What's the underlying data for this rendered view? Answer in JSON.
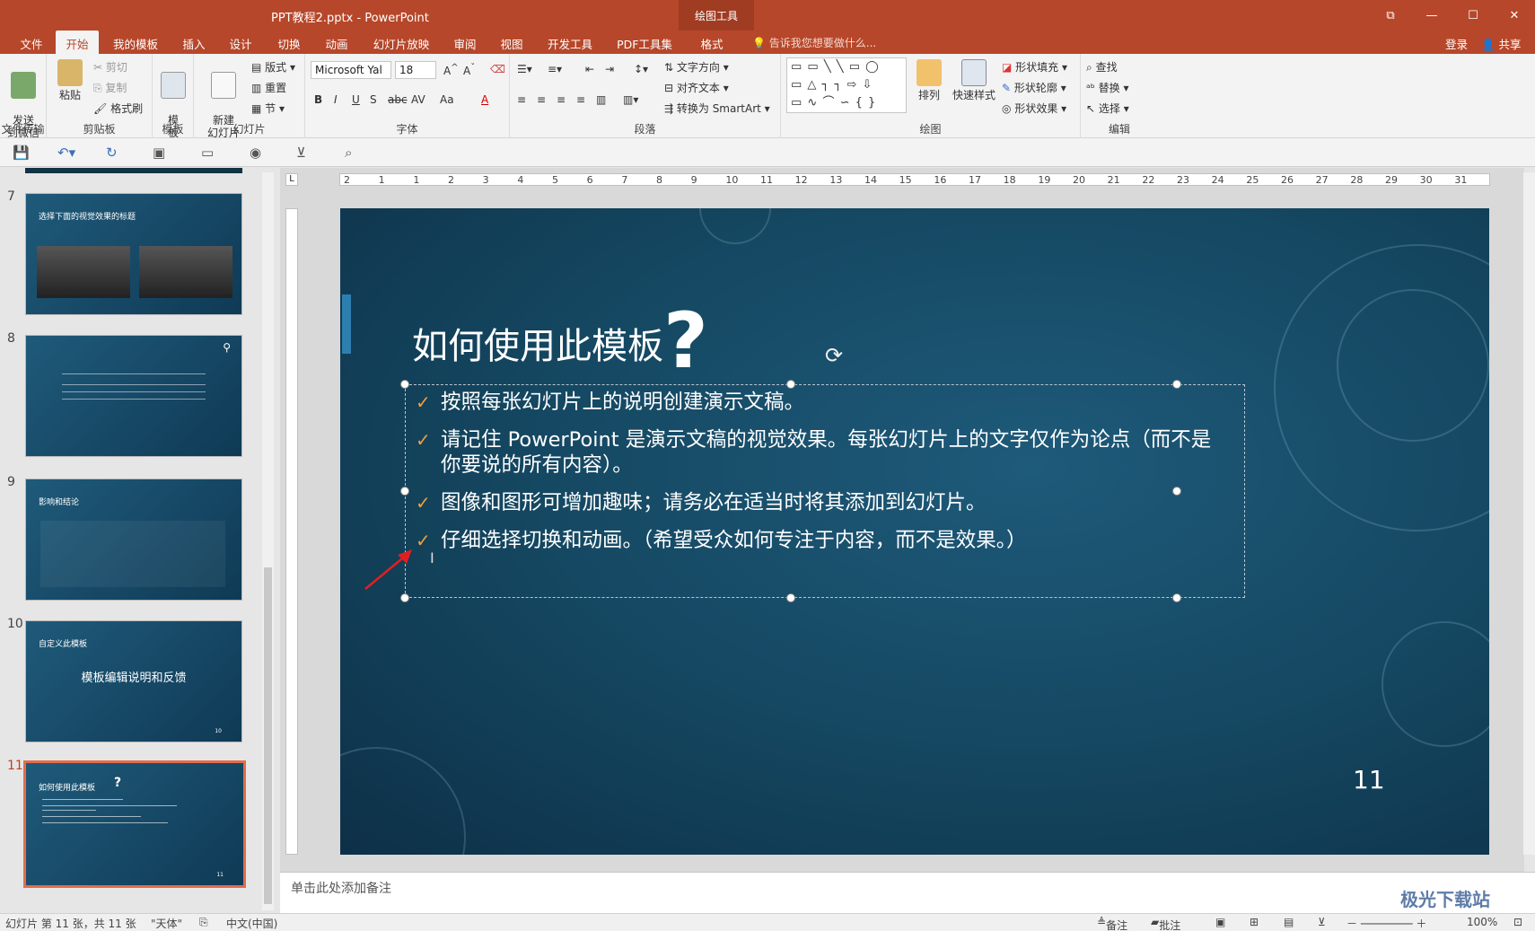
{
  "app": {
    "doc_title": "PPT教程2.pptx - PowerPoint",
    "context_tab_title": "绘图工具",
    "window_buttons": [
      "⧉",
      "—",
      "☐",
      "✕"
    ]
  },
  "tabs": [
    {
      "label": "文件"
    },
    {
      "label": "开始"
    },
    {
      "label": "我的模板"
    },
    {
      "label": "插入"
    },
    {
      "label": "设计"
    },
    {
      "label": "切换"
    },
    {
      "label": "动画"
    },
    {
      "label": "幻灯片放映"
    },
    {
      "label": "审阅"
    },
    {
      "label": "视图"
    },
    {
      "label": "开发工具"
    },
    {
      "label": "PDF工具集"
    },
    {
      "label": "格式"
    }
  ],
  "tell_me": "告诉我您想要做什么...",
  "login": "登录",
  "share": "共享",
  "ribbon": {
    "send_wechat": "发送\n到微信",
    "group_file_transfer": "文件传输",
    "paste": "粘贴",
    "cut": "剪切",
    "copy": "复制",
    "format_painter": "格式刷",
    "group_clipboard": "剪贴板",
    "template": "模\n板",
    "group_template": "模板",
    "new_slide": "新建\n幻灯片",
    "layout": "版式",
    "reset": "重置",
    "section": "节",
    "group_slides": "幻灯片",
    "font_name": "Microsoft Yal",
    "font_size": "18",
    "group_font": "字体",
    "text_direction": "文字方向",
    "align_text": "对齐文本",
    "convert_smartart": "转换为 SmartArt",
    "group_paragraph": "段落",
    "shapes_row1": "▭ ▭ ╲ ╲ ▭ ◯",
    "shapes_row2": "▭ △ ┐ ┐ ⇨ ⇩",
    "shapes_row3": "▭ ∿ ⌒ ∽ { }",
    "arrange": "排列",
    "quick_styles": "快速样式",
    "shape_fill": "形状填充",
    "shape_outline": "形状轮廓",
    "shape_effects": "形状效果",
    "group_drawing": "绘图",
    "find": "查找",
    "replace": "替换",
    "select": "选择",
    "group_editing": "编辑"
  },
  "thumbnails": [
    {
      "num": "7",
      "title": "选择下面的视觉效果的标题"
    },
    {
      "num": "8",
      "title": ""
    },
    {
      "num": "9",
      "title": "影响和结论"
    },
    {
      "num": "10",
      "title": "自定义此模板",
      "subtitle": "模板编辑说明和反馈",
      "page": "10"
    },
    {
      "num": "11",
      "title": "如何使用此模板",
      "page": "11"
    }
  ],
  "ruler_ticks": [
    "2",
    "1",
    "1",
    "2",
    "3",
    "4",
    "5",
    "6",
    "7",
    "8",
    "9",
    "10",
    "11",
    "12",
    "13",
    "14",
    "15",
    "16",
    "17",
    "18",
    "19",
    "20",
    "21",
    "22",
    "23",
    "24",
    "25",
    "26",
    "27",
    "28",
    "29",
    "30",
    "31"
  ],
  "slide": {
    "title": "如何使用此模板",
    "title_mark": "?",
    "page_number": "11",
    "bullets": [
      "按照每张幻灯片上的说明创建演示文稿。",
      "请记住 PowerPoint 是演示文稿的视觉效果。每张幻灯片上的文字仅作为论点（而不是你要说的所有内容）。",
      "图像和图形可增加趣味；请务必在适当时将其添加到幻灯片。",
      "仔细选择切换和动画。（希望受众如何专注于内容，而不是效果。）"
    ],
    "check_color": "#f0a03c"
  },
  "notes_placeholder": "单击此处添加备注",
  "status": {
    "slide_info": "幻灯片 第 11 张，共 11 张",
    "theme": "\"天体\"",
    "language": "中文(中国)",
    "notes": "备注",
    "comments": "批注",
    "zoom": "100%"
  },
  "watermark": "极光下载站",
  "accent_color": "#b7472a"
}
